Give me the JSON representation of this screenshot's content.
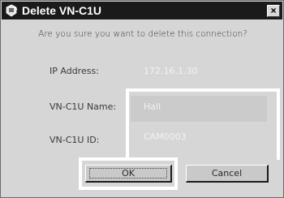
{
  "window": {
    "title": "Delete VN-C1U",
    "close_label": "×"
  },
  "prompt": "Are you sure you want to delete this connection?",
  "fields": {
    "ip_label": "IP Address:",
    "ip_value": "172.16.1.30",
    "name_label": "VN-C1U Name:",
    "name_value": "Hall",
    "id_label": "VN-C1U ID:",
    "id_value": "CAM0003"
  },
  "buttons": {
    "ok": "OK",
    "cancel": "Cancel"
  },
  "colors": {
    "titlebar": "#1a1a1a",
    "dialog_bg": "#d6d6d6",
    "highlight": "#ffffff"
  }
}
